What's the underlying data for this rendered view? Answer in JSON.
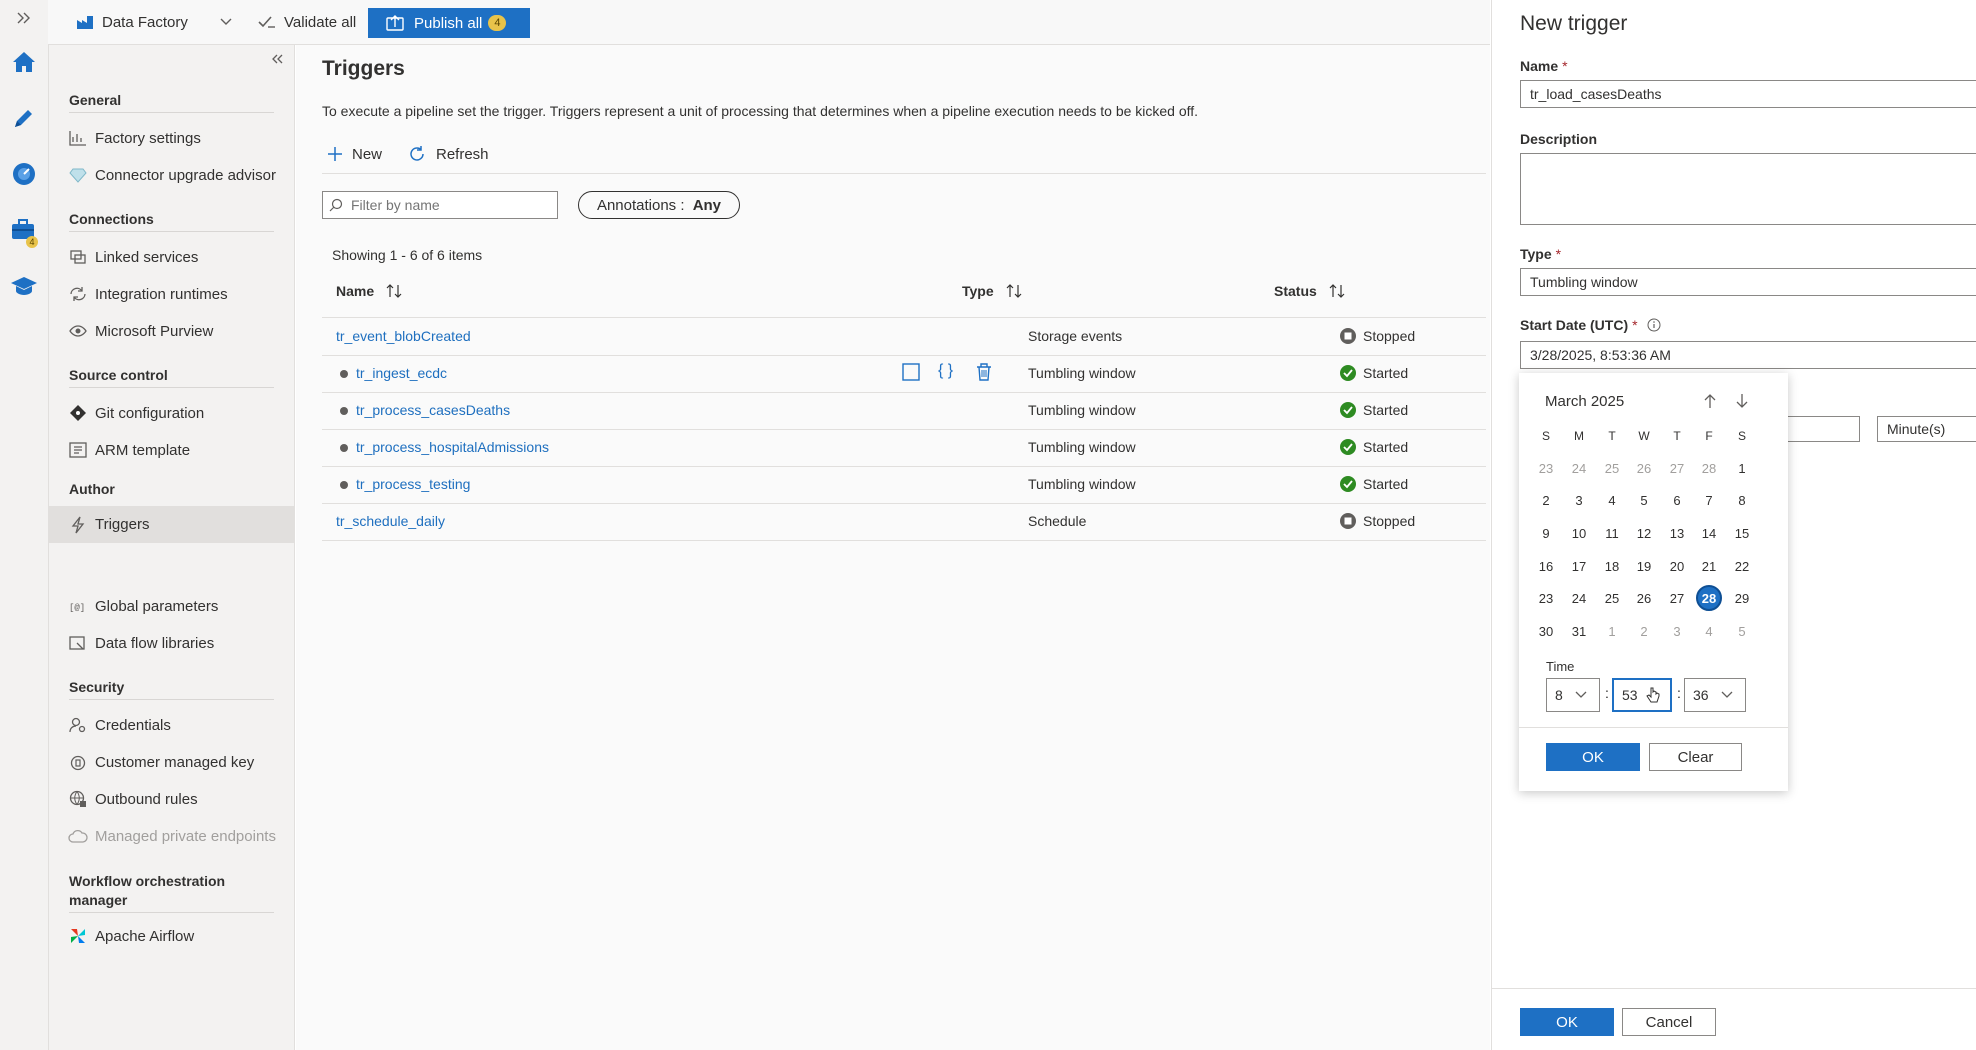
{
  "topbar": {
    "factory_label": "Data Factory",
    "validate_label": "Validate all",
    "publish_label": "Publish all",
    "publish_count": "4"
  },
  "rail": {
    "author_badge": "4"
  },
  "nav": {
    "sections": {
      "general": "General",
      "connections": "Connections",
      "source_control": "Source control",
      "author": "Author",
      "security": "Security",
      "workflow": "Workflow orchestration manager"
    },
    "items": {
      "factory_settings": "Factory settings",
      "connector_upgrade": "Connector upgrade advisor",
      "linked_services": "Linked services",
      "integration_runtimes": "Integration runtimes",
      "purview": "Microsoft Purview",
      "git": "Git configuration",
      "arm": "ARM template",
      "triggers": "Triggers",
      "global_params": "Global parameters",
      "dataflow_libs": "Data flow libraries",
      "credentials": "Credentials",
      "cmk": "Customer managed key",
      "outbound": "Outbound rules",
      "private_endpoints": "Managed private endpoints",
      "airflow": "Apache Airflow"
    }
  },
  "main": {
    "title": "Triggers",
    "description": "To execute a pipeline set the trigger. Triggers represent a unit of processing that determines when a pipeline execution needs to be kicked off.",
    "new_label": "New",
    "refresh_label": "Refresh",
    "filter_placeholder": "Filter by name",
    "annotations_label": "Annotations : ",
    "annotations_value": "Any",
    "showing": "Showing 1 - 6 of 6 items",
    "columns": {
      "name": "Name",
      "type": "Type",
      "status": "Status"
    },
    "rows": [
      {
        "name": "tr_event_blobCreated",
        "type": "Storage events",
        "status": "Stopped"
      },
      {
        "name": "tr_ingest_ecdc",
        "type": "Tumbling window",
        "status": "Started"
      },
      {
        "name": "tr_process_casesDeaths",
        "type": "Tumbling window",
        "status": "Started"
      },
      {
        "name": "tr_process_hospitalAdmissions",
        "type": "Tumbling window",
        "status": "Started"
      },
      {
        "name": "tr_process_testing",
        "type": "Tumbling window",
        "status": "Started"
      },
      {
        "name": "tr_schedule_daily",
        "type": "Schedule",
        "status": "Stopped"
      }
    ]
  },
  "panel": {
    "title": "New trigger",
    "name_label": "Name",
    "name_value": "tr_load_casesDeaths",
    "description_label": "Description",
    "type_label": "Type",
    "type_value": "Tumbling window",
    "start_label": "Start Date (UTC)",
    "start_value": "3/28/2025, 8:53:36 AM",
    "recurrence_unit": "Minute(s)",
    "ok_label": "OK",
    "cancel_label": "Cancel"
  },
  "calendar": {
    "month_label": "March 2025",
    "weekdays": [
      "S",
      "M",
      "T",
      "W",
      "T",
      "F",
      "S"
    ],
    "weeks": [
      [
        "23",
        "24",
        "25",
        "26",
        "27",
        "28",
        "1"
      ],
      [
        "2",
        "3",
        "4",
        "5",
        "6",
        "7",
        "8"
      ],
      [
        "9",
        "10",
        "11",
        "12",
        "13",
        "14",
        "15"
      ],
      [
        "16",
        "17",
        "18",
        "19",
        "20",
        "21",
        "22"
      ],
      [
        "23",
        "24",
        "25",
        "26",
        "27",
        "28",
        "29"
      ],
      [
        "30",
        "31",
        "1",
        "2",
        "3",
        "4",
        "5"
      ]
    ],
    "selected": "28",
    "time_label": "Time",
    "hour": "8",
    "minute": "53",
    "second": "36",
    "ok_label": "OK",
    "clear_label": "Clear"
  },
  "colors": {
    "accent": "#1e70c4",
    "link": "#1e6fbf",
    "started": "#2e8b22",
    "badge": "#e8c34a"
  }
}
